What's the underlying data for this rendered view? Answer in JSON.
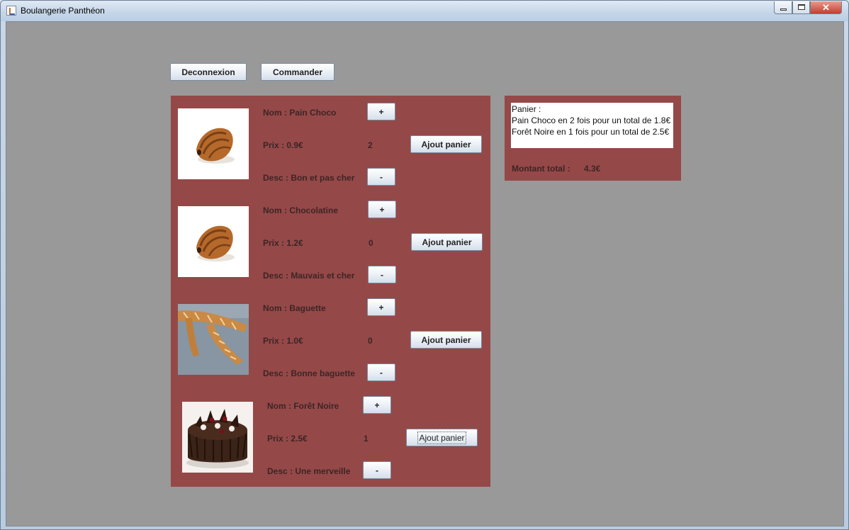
{
  "window": {
    "title": "Boulangerie Panthéon",
    "icon": "java-cup-icon"
  },
  "toolbar": {
    "logout_label": "Deconnexion",
    "order_label": "Commander"
  },
  "products": [
    {
      "name": "Nom : Pain Choco",
      "price": "Prix : 0.9€",
      "desc": "Desc : Bon et pas cher",
      "qty": "2",
      "plus": "+",
      "minus": "-",
      "add": "Ajout panier",
      "image": "pain-au-chocolat"
    },
    {
      "name": "Nom : Chocolatine",
      "price": "Prix : 1.2€",
      "desc": "Desc : Mauvais et cher",
      "qty": "0",
      "plus": "+",
      "minus": "-",
      "add": "Ajout panier",
      "image": "pain-au-chocolat"
    },
    {
      "name": "Nom : Baguette",
      "price": "Prix : 1.0€",
      "desc": "Desc : Bonne baguette",
      "qty": "0",
      "plus": "+",
      "minus": "-",
      "add": "Ajout panier",
      "image": "baguette"
    },
    {
      "name": "Nom : Forêt Noire",
      "price": "Prix : 2.5€",
      "desc": "Desc : Une merveille",
      "qty": "1",
      "plus": "+",
      "minus": "-",
      "add": "Ajout panier",
      "image": "black-forest-cake"
    }
  ],
  "cart": {
    "header": "Panier :",
    "lines": [
      "Pain Choco en 2 fois pour un total de 1.8€",
      "Forêt Noire en 1 fois pour un total de 2.5€"
    ],
    "total_label": "Montant total :",
    "total_value": "4.3€"
  },
  "colors": {
    "panel": "#954848",
    "background": "#999999"
  }
}
